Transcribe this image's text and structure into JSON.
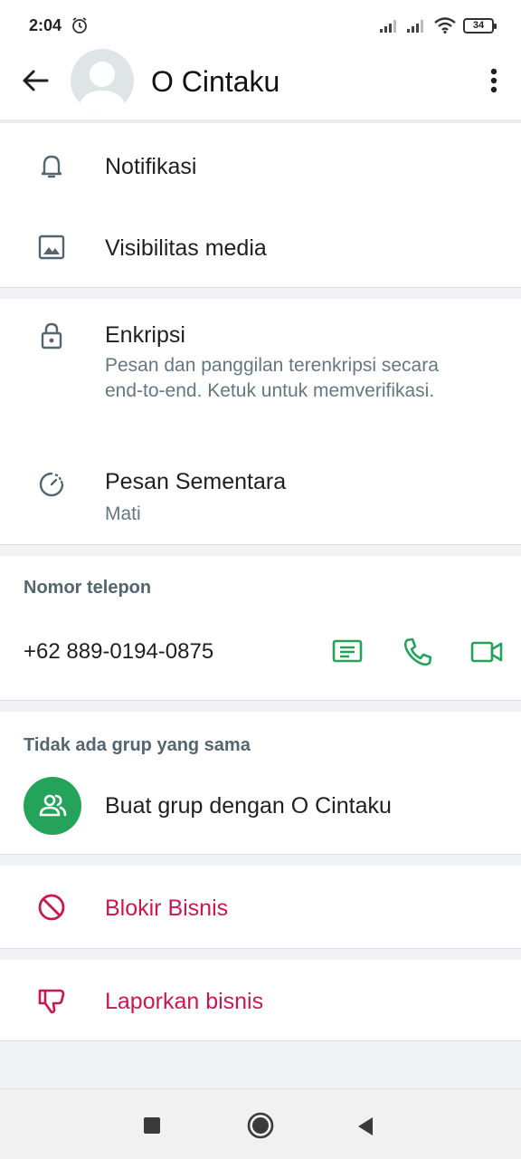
{
  "status_bar": {
    "time": "2:04",
    "battery": "34",
    "icons": [
      "alarm-icon",
      "signal-icon",
      "signal-icon",
      "wifi-icon",
      "battery-icon"
    ]
  },
  "header": {
    "title": "O Cintaku",
    "icons": [
      "back-arrow-icon",
      "avatar-placeholder-icon",
      "more-vert-icon"
    ]
  },
  "settings": {
    "notifications": {
      "label": "Notifikasi",
      "icon": "bell-icon"
    },
    "media_visibility": {
      "label": "Visibilitas media",
      "icon": "image-icon"
    }
  },
  "privacy": {
    "encryption": {
      "label": "Enkripsi",
      "description": "Pesan dan panggilan terenkripsi secara end-to-end. Ketuk untuk memverifikasi.",
      "icon": "lock-icon"
    },
    "disappearing": {
      "label": "Pesan Sementara",
      "value": "Mati",
      "icon": "timer-icon"
    }
  },
  "phone": {
    "section_label": "Nomor telepon",
    "number": "+62 889-0194-0875",
    "actions": [
      "message-icon",
      "call-icon",
      "video-call-icon"
    ]
  },
  "groups": {
    "section_label": "Tidak ada grup yang sama",
    "create_label": "Buat grup dengan O Cintaku",
    "icon": "group-icon"
  },
  "block": {
    "label": "Blokir Bisnis",
    "icon": "block-icon"
  },
  "report": {
    "label": "Laporkan bisnis",
    "icon": "thumbs-down-icon"
  },
  "colors": {
    "accent_green": "#25a35a",
    "danger_red": "#c8194f",
    "secondary_text": "#667781"
  },
  "nav_bar": {
    "icons": [
      "recents-square-icon",
      "home-circle-icon",
      "back-triangle-icon"
    ]
  }
}
